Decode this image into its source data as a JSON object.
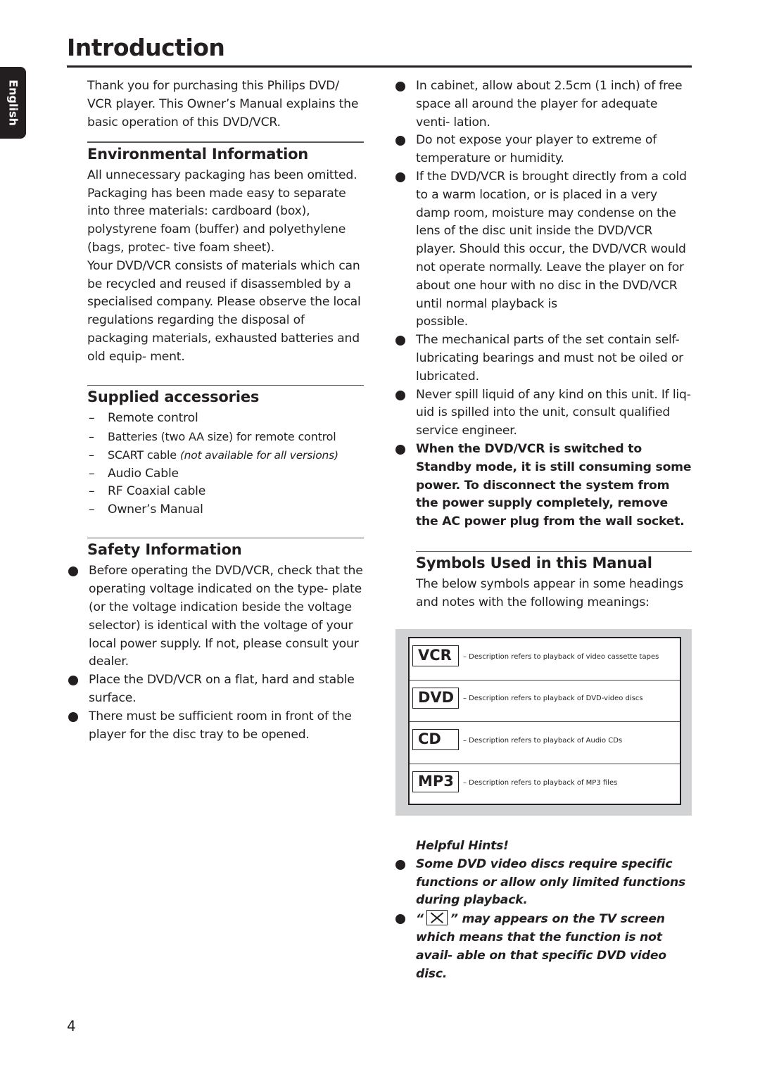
{
  "page": {
    "title": "Introduction",
    "language_tab": "English",
    "page_number": "4"
  },
  "intro": {
    "text": "Thank you for purchasing this Philips DVD/ VCR player. This Owner’s Manual explains the basic operation of this DVD/VCR."
  },
  "environmental": {
    "heading": "Environmental Information",
    "paragraph1": "All unnecessary packaging has been omitted. Packaging has been made easy to separate into three materials: cardboard (box), polystyrene foam (buffer) and polyethylene (bags, protec- tive foam sheet).",
    "paragraph2": "Your DVD/VCR consists of materials which can be recycled and reused if disassembled by a specialised company. Please observe the local regulations regarding the disposal of packaging materials, exhausted batteries and old equip- ment."
  },
  "accessories": {
    "heading": "Supplied accessories",
    "items": [
      {
        "text": "Remote control",
        "note": ""
      },
      {
        "text": "Batteries (two AA size) for remote control",
        "note": ""
      },
      {
        "text": "SCART cable ",
        "note": "(not available for all versions)"
      },
      {
        "text": "Audio Cable",
        "note": ""
      },
      {
        "text": "RF Coaxial cable",
        "note": ""
      },
      {
        "text": "Owner’s Manual",
        "note": ""
      }
    ]
  },
  "safety": {
    "heading": "Safety Information",
    "items": [
      "Before operating the DVD/VCR, check that the operating voltage indicated on the type- plate (or the voltage indication beside the voltage selector) is identical with the voltage of your local power supply. If not, please consult your dealer.",
      "Place the DVD/VCR on a flat, hard and stable surface.",
      "There must be sufficient room in front of the player for the disc tray to be opened."
    ]
  },
  "safety_continued": {
    "items": [
      "In cabinet, allow about 2.5cm (1 inch) of free space all around the player for adequate venti- lation.",
      "Do not expose your player to extreme of temperature or humidity.",
      "If the DVD/VCR is brought directly from a cold to a warm location, or is placed in a very damp room, moisture may condense on the lens of the disc unit inside the DVD/VCR player. Should this occur, the DVD/VCR would not operate normally. Leave the player on for about one hour with no disc in the DVD/VCR until normal playback is",
      "The mechanical parts of the set contain self- lubricating bearings and must not be oiled or lubricated.",
      "Never spill liquid of any kind on this unit. If liq- uid is spilled into the unit, consult qualified service engineer."
    ],
    "item3_tail": "possible.",
    "warning": "When the DVD/VCR is switched to Standby mode, it is still consuming some power.  To disconnect the system from the power supply completely, remove the AC power plug from the wall socket."
  },
  "symbols": {
    "heading": "Symbols Used in this Manual",
    "intro": "The below symbols appear in some headings and notes with the following meanings:",
    "rows": [
      {
        "badge": "VCR",
        "description": "– Description refers to playback of video cassette tapes"
      },
      {
        "badge": "DVD",
        "description": "– Description refers to playback of DVD-video discs"
      },
      {
        "badge": "CD",
        "description": "– Description refers to playback of Audio CDs"
      },
      {
        "badge": "MP3",
        "description": "– Description refers to playback of MP3 files"
      }
    ]
  },
  "hints": {
    "title": "Helpful Hints!",
    "item1": "Some DVD video discs require specific functions or allow only limited functions during playback.",
    "item2_prefix": "“",
    "item2_icon": "not-available-x-icon",
    "item2_suffix": "” may appears on the TV screen which means that the function is not avail- able on that specific DVD video disc."
  },
  "colors": {
    "text": "#231f20",
    "panel_gray": "#d1d2d3",
    "background": "#ffffff"
  }
}
